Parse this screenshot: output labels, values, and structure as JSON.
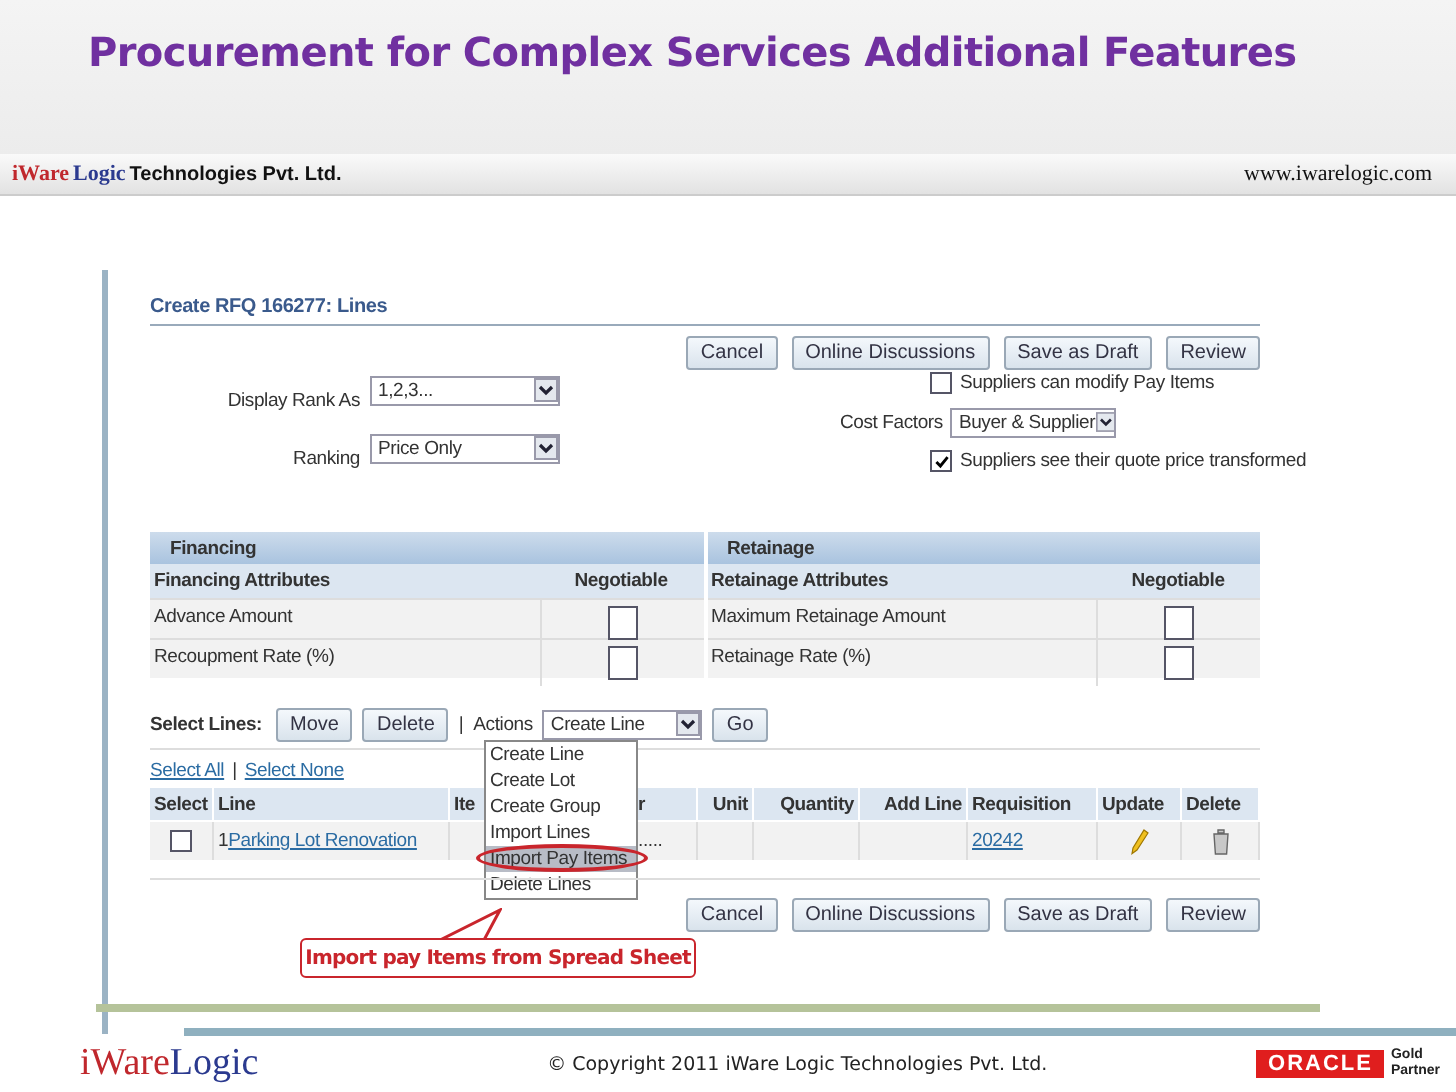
{
  "slide": {
    "title": "Procurement for Complex Services Additional Features",
    "brand": [
      {
        "text": "iWare",
        "color": "#c0282d"
      },
      {
        "text": "Logic",
        "color": "#2b3a8f"
      }
    ],
    "brand_suffix": "Technologies Pvt. Ltd.",
    "website": "www.iwarelogic.com"
  },
  "page": {
    "title": "Create RFQ 166277: Lines",
    "buttons": [
      "Cancel",
      "Online Discussions",
      "Save as Draft",
      "Review"
    ],
    "display_rank_as": {
      "label": "Display Rank As",
      "value": "1,2,3..."
    },
    "ranking": {
      "label": "Ranking",
      "value": "Price Only"
    },
    "suppliers_modify": {
      "label": "Suppliers can modify Pay Items",
      "checked": false
    },
    "cost_factors": {
      "label": "Cost Factors",
      "value": "Buyer & Supplier"
    },
    "suppliers_see": {
      "label": "Suppliers see their quote price transformed",
      "checked": true
    }
  },
  "sections": [
    {
      "title": "Financing",
      "columns": [
        "Financing Attributes",
        "Negotiable"
      ],
      "rows": [
        {
          "name": "Advance Amount",
          "negotiable": false
        },
        {
          "name": "Recoupment Rate (%)",
          "negotiable": false
        }
      ]
    },
    {
      "title": "Retainage",
      "columns": [
        "Retainage Attributes",
        "Negotiable"
      ],
      "rows": [
        {
          "name": "Maximum Retainage Amount",
          "negotiable": false
        },
        {
          "name": "Retainage Rate (%)",
          "negotiable": false
        }
      ]
    }
  ],
  "lines": {
    "label": "Select Lines:",
    "buttons": [
      "Move",
      "Delete"
    ],
    "actions_separator": "|",
    "actions_label": "Actions",
    "actions_value": "Create Line",
    "go": "Go",
    "select_all": "Select All",
    "links_separator": "|",
    "select_none": "Select None",
    "columns": [
      "Select",
      "Line",
      "Ite",
      "r",
      "Unit",
      "Quantity",
      "Add Line",
      "Requisition",
      "Update",
      "Delete"
    ],
    "rows": [
      {
        "selected": false,
        "line": "1",
        "description": "Parking Lot Renovation",
        "column_4": ".....",
        "requisition": "20242"
      }
    ]
  },
  "menu": [
    {
      "label": "Create Line",
      "selected": false
    },
    {
      "label": "Create Lot",
      "selected": false
    },
    {
      "label": "Create Group",
      "selected": false
    },
    {
      "label": "Import Lines",
      "selected": false
    },
    {
      "label": "Import Pay Items",
      "selected": true
    },
    {
      "label": "Delete Lines",
      "selected": false
    }
  ],
  "callout": "Import pay Items from Spread Sheet",
  "bottom_buttons": [
    "Cancel",
    "Online Discussions",
    "Save as Draft",
    "Review"
  ],
  "footer": {
    "brand": [
      {
        "text": "iWare",
        "color": "#c0282d"
      },
      {
        "text": "Logic",
        "color": "#2b3a8f"
      }
    ],
    "copyright": "© Copyright 2011 iWare Logic Technologies Pvt. Ltd.",
    "partner_logo": "ORACLE",
    "partner_text": [
      "Gold",
      "Partner"
    ]
  }
}
